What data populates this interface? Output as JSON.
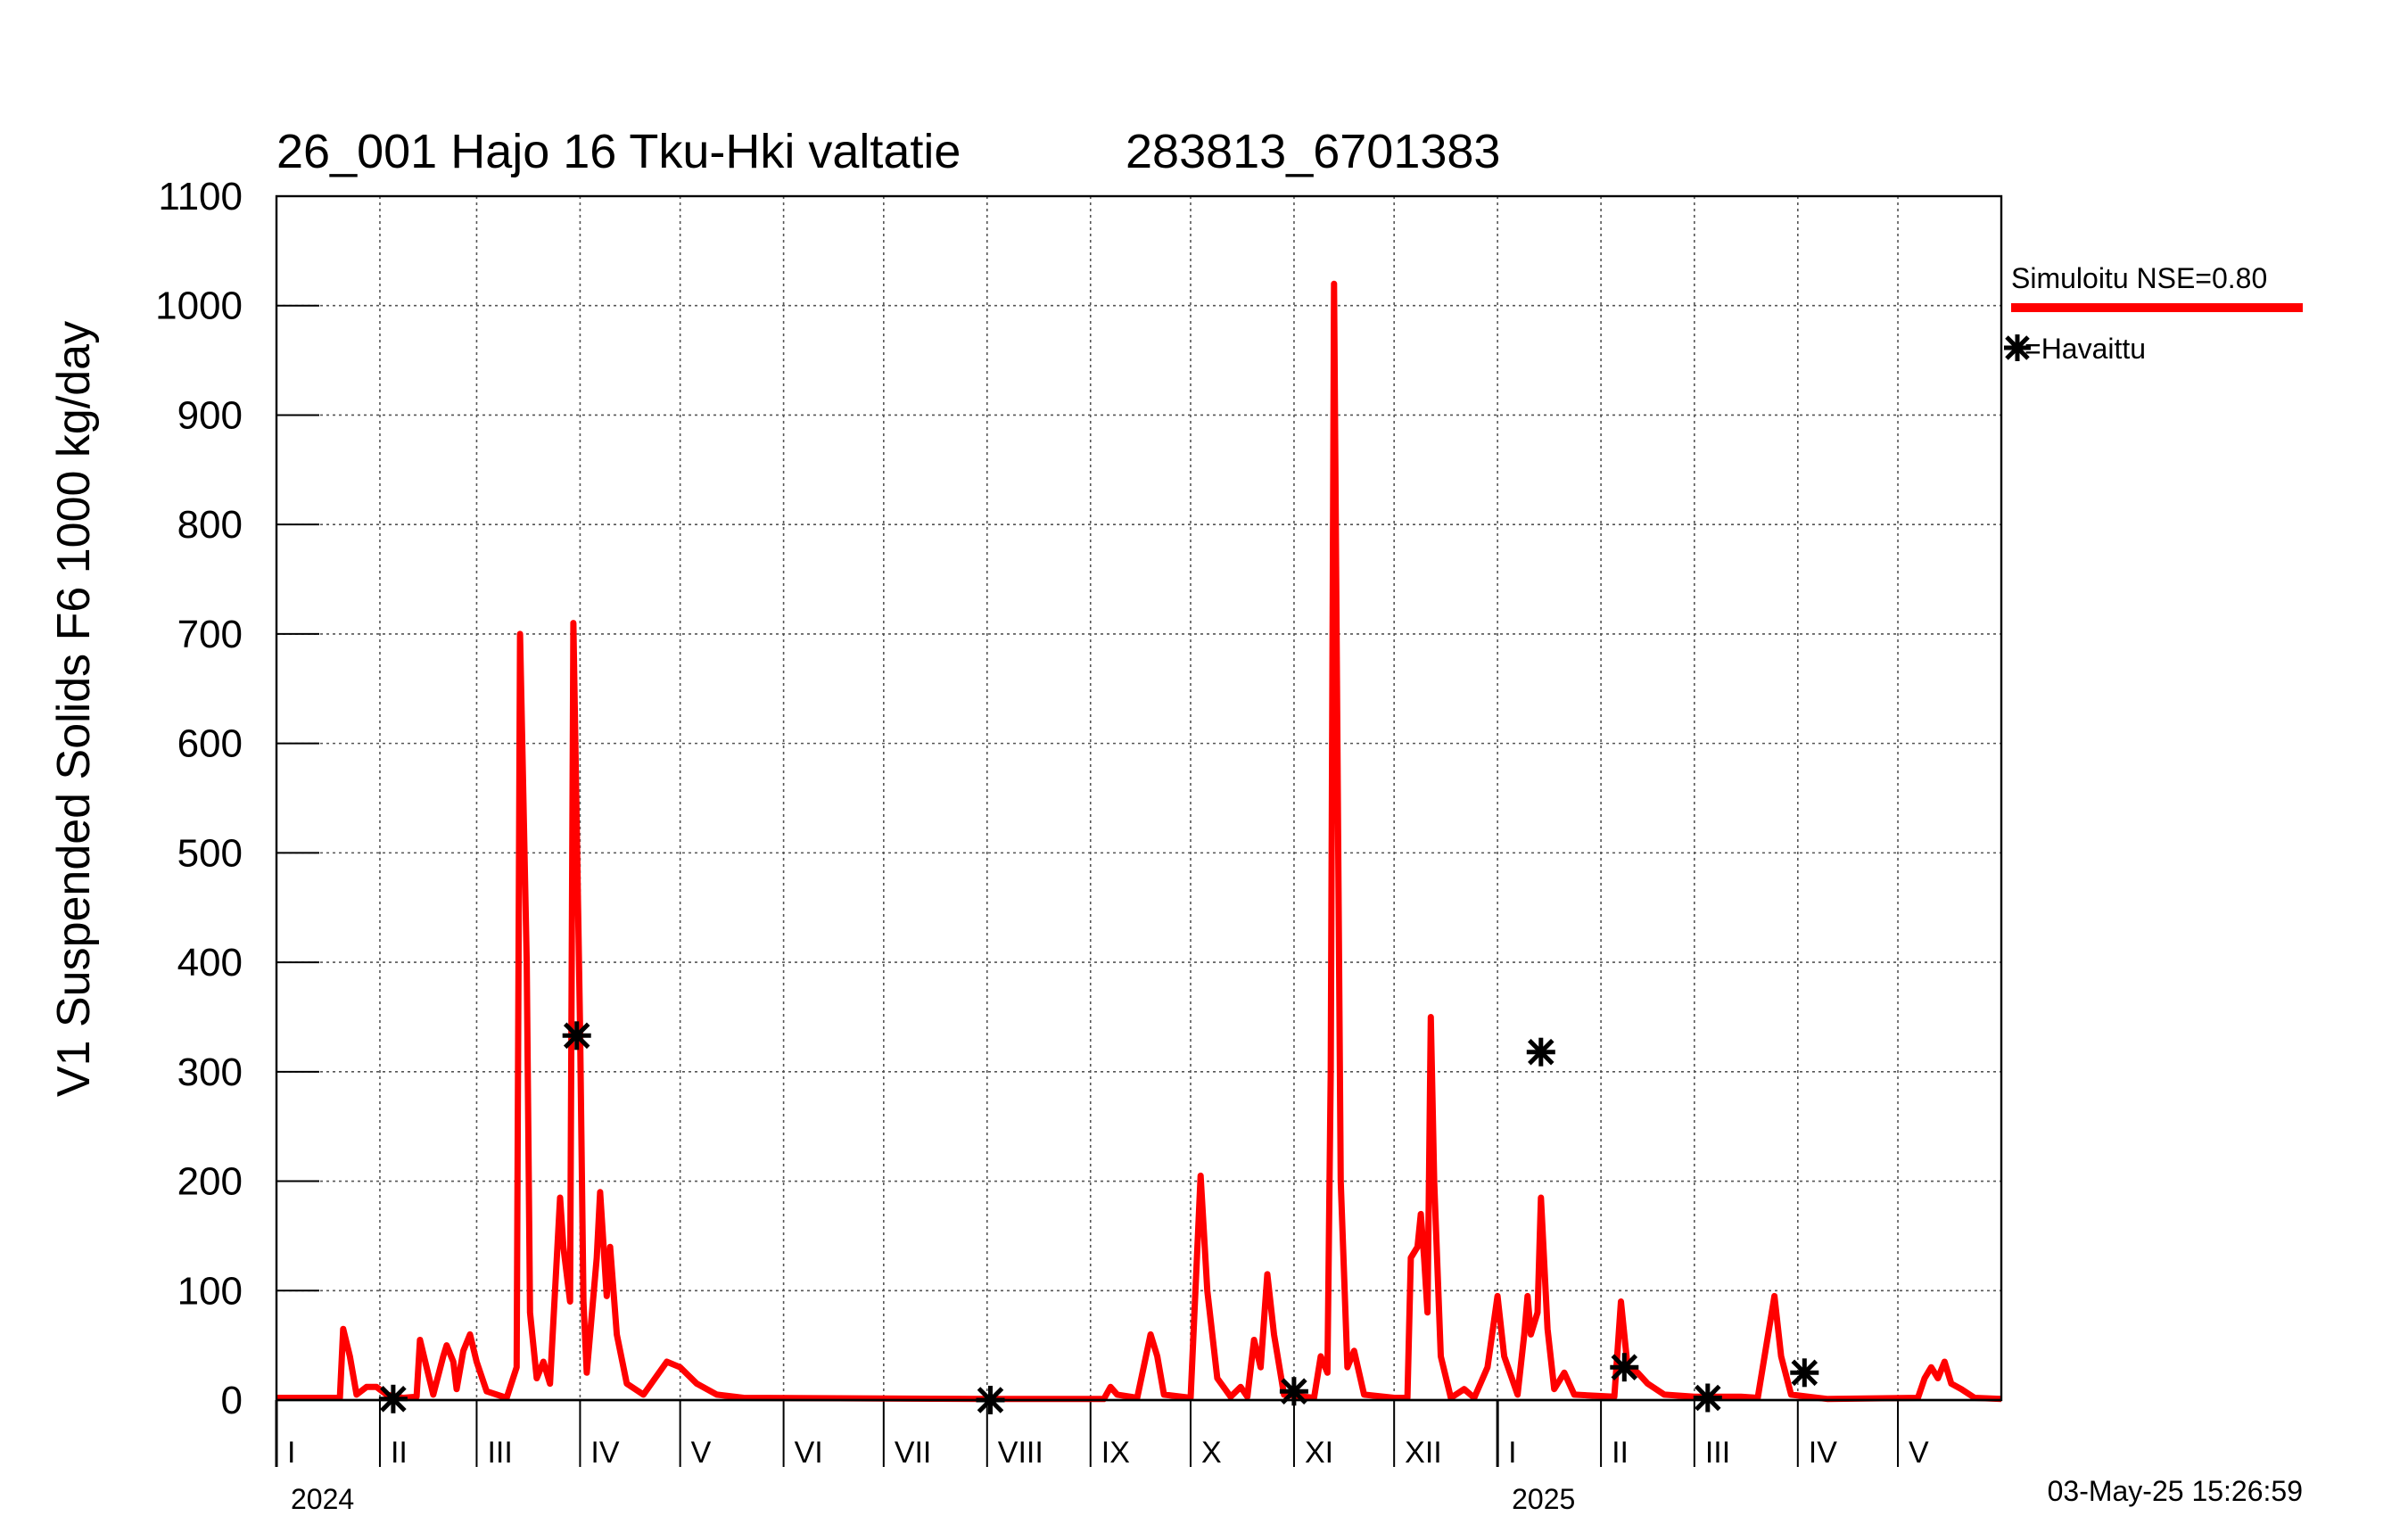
{
  "chart_data": {
    "type": "line",
    "title": "26_001 Hajo 16 Tku-Hki valtatie",
    "subtitle": "283813_6701383",
    "ylabel": "V1 Suspended Solids F6 1000 kg/day",
    "ylim": [
      0,
      1100
    ],
    "yticks": [
      0,
      100,
      200,
      300,
      400,
      500,
      600,
      700,
      800,
      900,
      1000,
      1100
    ],
    "grid": true,
    "legend_position": "right",
    "x_range": [
      "2024-01-01",
      "2025-06-01"
    ],
    "month_labels": [
      "I",
      "II",
      "III",
      "IV",
      "V",
      "VI",
      "VII",
      "VIII",
      "IX",
      "X",
      "XI",
      "XII",
      "I",
      "II",
      "III",
      "IV",
      "V"
    ],
    "year_labels": [
      {
        "label": "2024",
        "date": "2024-01-01"
      },
      {
        "label": "2025",
        "date": "2025-01-01"
      }
    ],
    "timestamp": "03-May-25 15:26:59",
    "series": [
      {
        "name": "Simuloitu NSE=0.80",
        "color": "#ff0000",
        "style": "line",
        "points": [
          [
            "2024-01-01",
            2
          ],
          [
            "2024-01-20",
            2
          ],
          [
            "2024-01-21",
            65
          ],
          [
            "2024-01-23",
            40
          ],
          [
            "2024-01-25",
            5
          ],
          [
            "2024-01-28",
            12
          ],
          [
            "2024-01-31",
            12
          ],
          [
            "2024-02-03",
            5
          ],
          [
            "2024-02-08",
            2
          ],
          [
            "2024-02-12",
            3
          ],
          [
            "2024-02-13",
            55
          ],
          [
            "2024-02-15",
            30
          ],
          [
            "2024-02-17",
            5
          ],
          [
            "2024-02-20",
            40
          ],
          [
            "2024-02-21",
            50
          ],
          [
            "2024-02-23",
            35
          ],
          [
            "2024-02-24",
            10
          ],
          [
            "2024-02-26",
            45
          ],
          [
            "2024-02-28",
            60
          ],
          [
            "2024-03-01",
            35
          ],
          [
            "2024-03-04",
            8
          ],
          [
            "2024-03-10",
            2
          ],
          [
            "2024-03-13",
            30
          ],
          [
            "2024-03-14",
            700
          ],
          [
            "2024-03-16",
            400
          ],
          [
            "2024-03-17",
            80
          ],
          [
            "2024-03-19",
            20
          ],
          [
            "2024-03-21",
            35
          ],
          [
            "2024-03-23",
            15
          ],
          [
            "2024-03-26",
            185
          ],
          [
            "2024-03-27",
            140
          ],
          [
            "2024-03-29",
            90
          ],
          [
            "2024-03-30",
            710
          ],
          [
            "2024-04-01",
            340
          ],
          [
            "2024-04-02",
            90
          ],
          [
            "2024-04-03",
            25
          ],
          [
            "2024-04-06",
            130
          ],
          [
            "2024-04-07",
            190
          ],
          [
            "2024-04-09",
            95
          ],
          [
            "2024-04-10",
            140
          ],
          [
            "2024-04-12",
            60
          ],
          [
            "2024-04-15",
            15
          ],
          [
            "2024-04-20",
            5
          ],
          [
            "2024-04-27",
            35
          ],
          [
            "2024-05-01",
            30
          ],
          [
            "2024-05-06",
            15
          ],
          [
            "2024-05-12",
            5
          ],
          [
            "2024-05-20",
            2
          ],
          [
            "2024-08-01",
            1
          ],
          [
            "2024-09-05",
            1
          ],
          [
            "2024-09-07",
            12
          ],
          [
            "2024-09-09",
            5
          ],
          [
            "2024-09-15",
            2
          ],
          [
            "2024-09-19",
            60
          ],
          [
            "2024-09-21",
            40
          ],
          [
            "2024-09-23",
            5
          ],
          [
            "2024-10-01",
            2
          ],
          [
            "2024-10-04",
            205
          ],
          [
            "2024-10-06",
            100
          ],
          [
            "2024-10-09",
            20
          ],
          [
            "2024-10-13",
            3
          ],
          [
            "2024-10-16",
            12
          ],
          [
            "2024-10-18",
            3
          ],
          [
            "2024-10-20",
            55
          ],
          [
            "2024-10-22",
            30
          ],
          [
            "2024-10-24",
            115
          ],
          [
            "2024-10-26",
            60
          ],
          [
            "2024-10-29",
            5
          ],
          [
            "2024-11-07",
            2
          ],
          [
            "2024-11-09",
            40
          ],
          [
            "2024-11-11",
            25
          ],
          [
            "2024-11-12",
            300
          ],
          [
            "2024-11-13",
            1020
          ],
          [
            "2024-11-14",
            600
          ],
          [
            "2024-11-15",
            200
          ],
          [
            "2024-11-17",
            30
          ],
          [
            "2024-11-19",
            45
          ],
          [
            "2024-11-22",
            5
          ],
          [
            "2024-12-01",
            2
          ],
          [
            "2024-12-05",
            2
          ],
          [
            "2024-12-06",
            130
          ],
          [
            "2024-12-08",
            140
          ],
          [
            "2024-12-09",
            170
          ],
          [
            "2024-12-10",
            130
          ],
          [
            "2024-12-11",
            80
          ],
          [
            "2024-12-12",
            350
          ],
          [
            "2024-12-13",
            200
          ],
          [
            "2024-12-15",
            40
          ],
          [
            "2024-12-18",
            2
          ],
          [
            "2024-12-22",
            10
          ],
          [
            "2024-12-25",
            2
          ],
          [
            "2024-12-29",
            30
          ],
          [
            "2025-01-01",
            95
          ],
          [
            "2025-01-03",
            40
          ],
          [
            "2025-01-07",
            5
          ],
          [
            "2025-01-09",
            60
          ],
          [
            "2025-01-10",
            95
          ],
          [
            "2025-01-11",
            60
          ],
          [
            "2025-01-13",
            80
          ],
          [
            "2025-01-14",
            185
          ],
          [
            "2025-01-16",
            65
          ],
          [
            "2025-01-18",
            10
          ],
          [
            "2025-01-21",
            25
          ],
          [
            "2025-01-24",
            5
          ],
          [
            "2025-02-05",
            3
          ],
          [
            "2025-02-07",
            90
          ],
          [
            "2025-02-09",
            30
          ],
          [
            "2025-02-12",
            25
          ],
          [
            "2025-02-15",
            15
          ],
          [
            "2025-02-20",
            5
          ],
          [
            "2025-03-01",
            3
          ],
          [
            "2025-03-15",
            3
          ],
          [
            "2025-03-20",
            2
          ],
          [
            "2025-03-25",
            95
          ],
          [
            "2025-03-27",
            40
          ],
          [
            "2025-03-30",
            5
          ],
          [
            "2025-04-10",
            1
          ],
          [
            "2025-05-07",
            2
          ],
          [
            "2025-05-09",
            20
          ],
          [
            "2025-05-11",
            30
          ],
          [
            "2025-05-13",
            20
          ],
          [
            "2025-05-15",
            35
          ],
          [
            "2025-05-17",
            15
          ],
          [
            "2025-05-20",
            10
          ],
          [
            "2025-05-24",
            2
          ],
          [
            "2025-06-01",
            1
          ]
        ]
      },
      {
        "name": "Havaittu",
        "color": "#000000",
        "style": "marker",
        "points": [
          [
            "2024-02-05",
            1
          ],
          [
            "2024-03-31",
            333
          ],
          [
            "2024-08-02",
            0
          ],
          [
            "2024-11-01",
            8
          ],
          [
            "2025-01-14",
            318
          ],
          [
            "2025-02-08",
            30
          ],
          [
            "2025-03-05",
            2
          ],
          [
            "2025-04-03",
            25
          ]
        ]
      }
    ]
  },
  "legend": {
    "simulated_label": "Simuloitu NSE=0.80",
    "observed_label": "=Havaittu"
  }
}
